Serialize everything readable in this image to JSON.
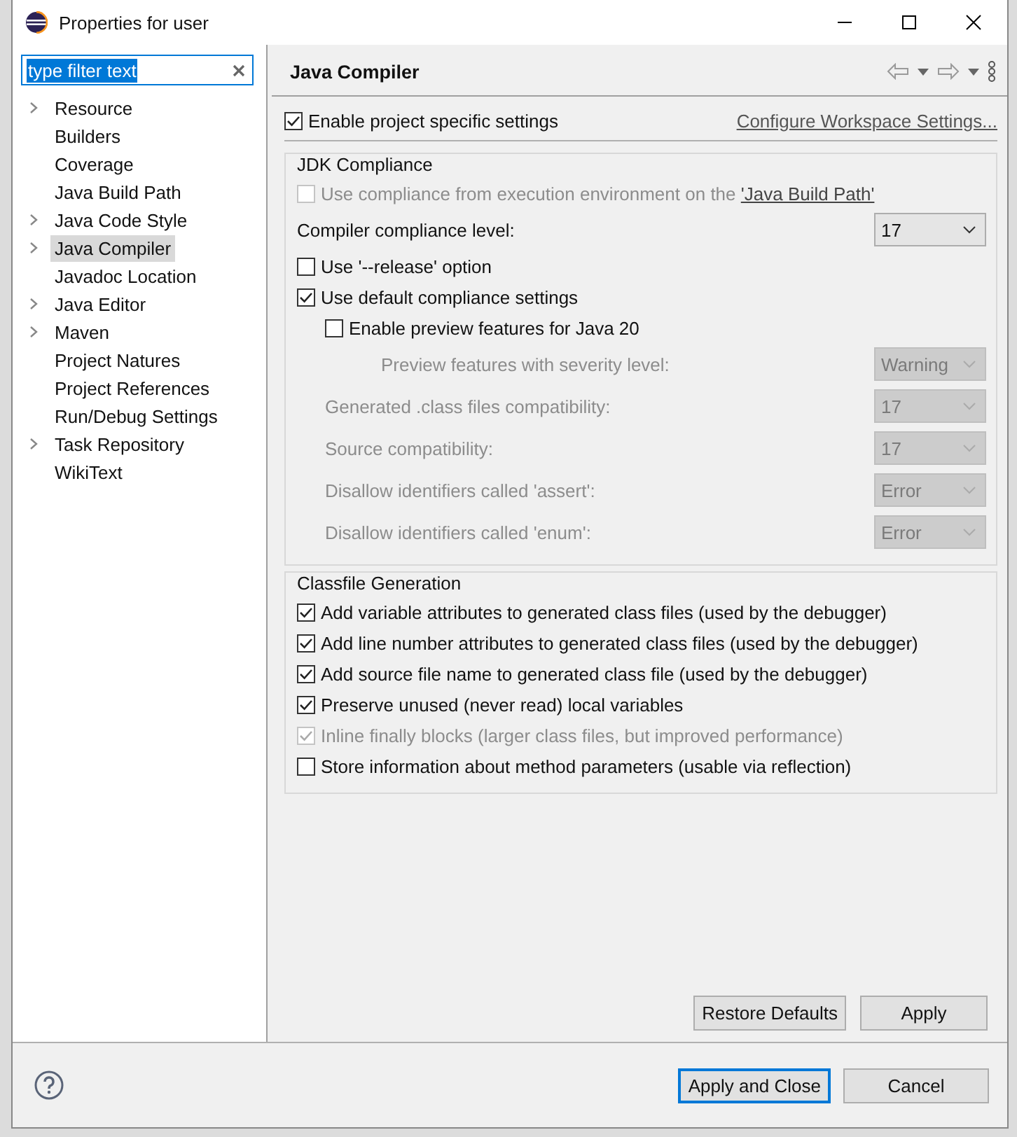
{
  "window": {
    "title": "Properties for user"
  },
  "filter": {
    "value": "type filter text",
    "selected": true
  },
  "tree": [
    {
      "label": "Resource",
      "expandable": true,
      "selected": false
    },
    {
      "label": "Builders",
      "expandable": false,
      "selected": false
    },
    {
      "label": "Coverage",
      "expandable": false,
      "selected": false
    },
    {
      "label": "Java Build Path",
      "expandable": false,
      "selected": false
    },
    {
      "label": "Java Code Style",
      "expandable": true,
      "selected": false
    },
    {
      "label": "Java Compiler",
      "expandable": true,
      "selected": true
    },
    {
      "label": "Javadoc Location",
      "expandable": false,
      "selected": false
    },
    {
      "label": "Java Editor",
      "expandable": true,
      "selected": false
    },
    {
      "label": "Maven",
      "expandable": true,
      "selected": false
    },
    {
      "label": "Project Natures",
      "expandable": false,
      "selected": false
    },
    {
      "label": "Project References",
      "expandable": false,
      "selected": false
    },
    {
      "label": "Run/Debug Settings",
      "expandable": false,
      "selected": false
    },
    {
      "label": "Task Repository",
      "expandable": true,
      "selected": false
    },
    {
      "label": "WikiText",
      "expandable": false,
      "selected": false
    }
  ],
  "page": {
    "title": "Java Compiler"
  },
  "enable_project": {
    "label": "Enable project specific settings",
    "checked": true
  },
  "configure_link": "Configure Workspace Settings...",
  "jdk": {
    "title": "JDK Compliance",
    "rows": [
      {
        "kind": "checkbox",
        "label": "Use compliance from execution environment on the ",
        "link": "'Java Build Path'",
        "checked": false,
        "disabled": true
      },
      {
        "kind": "combo",
        "label": "Compiler compliance level:",
        "value": "17",
        "disabled": false
      },
      {
        "kind": "checkbox",
        "label": "Use '--release' option",
        "checked": false,
        "disabled": false
      },
      {
        "kind": "checkbox",
        "label": "Use default compliance settings",
        "checked": true,
        "disabled": false,
        "children": [
          {
            "kind": "checkbox",
            "label": "Enable preview features for Java 20",
            "checked": false,
            "disabled": false,
            "children": [
              {
                "kind": "combo",
                "label": "Preview features with severity level:",
                "value": "Warning",
                "disabled": true
              }
            ]
          },
          {
            "kind": "combo",
            "label": "Generated .class files compatibility:",
            "value": "17",
            "disabled": true
          },
          {
            "kind": "combo",
            "label": "Source compatibility:",
            "value": "17",
            "disabled": true
          },
          {
            "kind": "combo",
            "label": "Disallow identifiers called 'assert':",
            "value": "Error",
            "disabled": true
          },
          {
            "kind": "combo",
            "label": "Disallow identifiers called 'enum':",
            "value": "Error",
            "disabled": true
          }
        ]
      }
    ]
  },
  "classfile": {
    "title": "Classfile Generation",
    "rows": [
      {
        "kind": "checkbox",
        "label": "Add variable attributes to generated class files (used by the debugger)",
        "checked": true,
        "disabled": false
      },
      {
        "kind": "checkbox",
        "label": "Add line number attributes to generated class files (used by the debugger)",
        "checked": true,
        "disabled": false
      },
      {
        "kind": "checkbox",
        "label": "Add source file name to generated class file (used by the debugger)",
        "checked": true,
        "disabled": false
      },
      {
        "kind": "checkbox",
        "label": "Preserve unused (never read) local variables",
        "checked": true,
        "disabled": false
      },
      {
        "kind": "checkbox",
        "label": "Inline finally blocks (larger class files, but improved performance)",
        "checked": true,
        "disabled": true
      },
      {
        "kind": "checkbox",
        "label": "Store information about method parameters (usable via reflection)",
        "checked": false,
        "disabled": false
      }
    ]
  },
  "page_buttons": [
    {
      "label": "Restore Defaults",
      "default": false
    },
    {
      "label": "Apply",
      "default": false
    }
  ],
  "dialog_buttons": [
    {
      "label": "Apply and Close",
      "default": true
    },
    {
      "label": "Cancel",
      "default": false
    }
  ]
}
